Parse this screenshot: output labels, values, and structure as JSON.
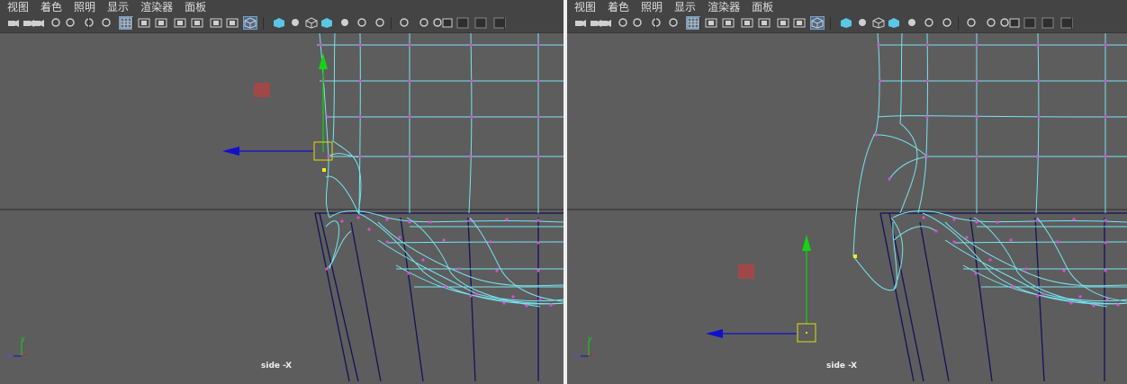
{
  "panels": [
    {
      "menu": [
        "视图",
        "着色",
        "照明",
        "显示",
        "渲染器",
        "面板"
      ],
      "camera_label": "side -X",
      "axis": {
        "y": "y",
        "z": "z"
      }
    },
    {
      "menu": [
        "视图",
        "着色",
        "照明",
        "显示",
        "渲染器",
        "面板"
      ],
      "camera_label": "side -X",
      "axis": {
        "y": "y",
        "z": "z"
      }
    }
  ],
  "toolbar_icons": [
    "camera-select-icon",
    "camera-lock-icon",
    "camera-attributes-icon",
    "bookmark-icon",
    "image-plane-icon",
    "grease-pencil-icon",
    "2d-pan-zoom-icon",
    "grid-icon",
    "film-gate-icon",
    "resolution-gate-icon",
    "gate-mask-icon",
    "field-chart-icon",
    "safe-action-icon",
    "safe-title-icon",
    "wireframe-icon",
    "smooth-shade-icon",
    "default-lighting-icon",
    "wireframe-on-shaded-icon",
    "textured-icon",
    "use-all-lights-icon",
    "shadows-icon",
    "screen-space-ao-icon",
    "motion-blur-icon",
    "multisample-aa-icon",
    "depth-of-field-icon",
    "isolate-select-icon",
    "xray-icon",
    "xray-joints-icon",
    "xray-components-icon"
  ],
  "colors": {
    "viewport_bg": "#5d5d5d",
    "wireframe": "#76e4ee",
    "vertex": "#d94cd9",
    "backface": "#12125a",
    "axis_x_arrow": "#1010cc",
    "axis_y_arrow": "#14d414",
    "manipulator": "#dddd10",
    "pivot_square": "#a04848"
  }
}
